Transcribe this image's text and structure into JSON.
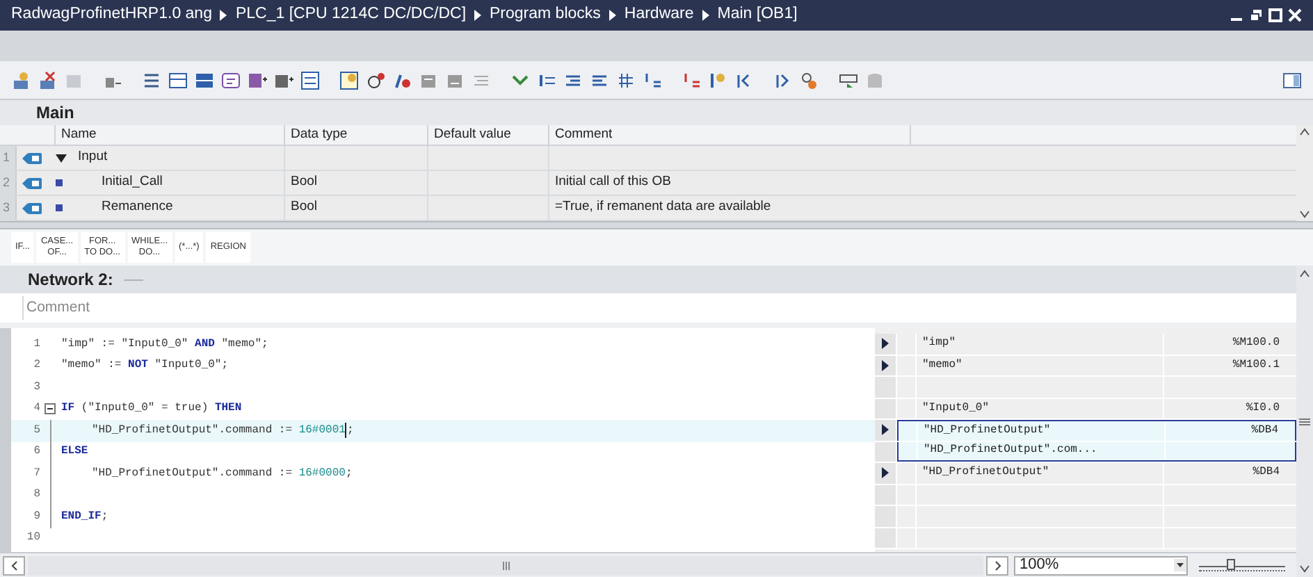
{
  "window": {
    "title_path": [
      "RadwagProfinetHRP1.0 ang",
      "PLC_1 [CPU 1214C DC/DC/DC]",
      "Program blocks",
      "Hardware",
      "Main [OB1]"
    ]
  },
  "block_interface": {
    "title": "Main",
    "columns": [
      "Name",
      "Data type",
      "Default value",
      "Comment"
    ],
    "rows": [
      {
        "number": "1",
        "name": "Input",
        "kind": "section",
        "expanded": true
      },
      {
        "number": "2",
        "name": "Initial_Call",
        "data_type": "Bool",
        "comment": "Initial call of this OB",
        "kind": "member"
      },
      {
        "number": "3",
        "name": "Remanence",
        "data_type": "Bool",
        "comment": "=True, if remanent data are available",
        "kind": "member"
      }
    ]
  },
  "snippets": [
    {
      "line1": "IF..."
    },
    {
      "line1": "CASE...",
      "line2": "OF..."
    },
    {
      "line1": "FOR...",
      "line2": "TO DO..."
    },
    {
      "line1": "WHILE...",
      "line2": "DO..."
    },
    {
      "line1": "(*...*)"
    },
    {
      "line1": "REGION"
    }
  ],
  "network": {
    "title": "Network 2:",
    "comment_placeholder": "Comment"
  },
  "code_lines": [
    {
      "number": "1",
      "fold": false,
      "selected": false,
      "tokens": [
        {
          "kind": "text",
          "text": "\"imp\" := \"Input0_0\" "
        },
        {
          "kind": "keyword",
          "text": "AND"
        },
        {
          "kind": "text",
          "text": " \"memo\";"
        }
      ]
    },
    {
      "number": "2",
      "fold": false,
      "selected": false,
      "tokens": [
        {
          "kind": "text",
          "text": "\"memo\" := "
        },
        {
          "kind": "keyword",
          "text": "NOT"
        },
        {
          "kind": "text",
          "text": " \"Input0_0\";"
        }
      ]
    },
    {
      "number": "3",
      "fold": false,
      "selected": false
    },
    {
      "number": "4",
      "fold": true,
      "selected": false,
      "tokens": [
        {
          "kind": "keyword",
          "text": "IF"
        },
        {
          "kind": "text",
          "text": " (\"Input0_0\" = true) "
        },
        {
          "kind": "keyword",
          "text": "THEN"
        }
      ]
    },
    {
      "number": "5",
      "fold": false,
      "selected": true,
      "indented": true,
      "tokens": [
        {
          "kind": "text",
          "text": "\"HD_ProfinetOutput\".command := "
        },
        {
          "kind": "number",
          "text": "16#0001"
        },
        {
          "kind": "cursor"
        },
        {
          "kind": "text",
          "text": ";"
        }
      ]
    },
    {
      "number": "6",
      "fold": false,
      "selected": false,
      "tokens": [
        {
          "kind": "keyword",
          "text": "ELSE"
        }
      ]
    },
    {
      "number": "7",
      "fold": false,
      "selected": false,
      "indented": true,
      "tokens": [
        {
          "kind": "text",
          "text": "\"HD_ProfinetOutput\".command := "
        },
        {
          "kind": "number",
          "text": "16#0000"
        },
        {
          "kind": "text",
          "text": ";"
        }
      ]
    },
    {
      "number": "8",
      "fold": false,
      "selected": false
    },
    {
      "number": "9",
      "fold": false,
      "selected": false,
      "tokens": [
        {
          "kind": "keyword",
          "text": "END_IF"
        },
        {
          "kind": "text",
          "text": ";"
        }
      ]
    },
    {
      "number": "10",
      "fold": false,
      "selected": false
    }
  ],
  "operands": [
    {
      "arrow": true,
      "selected": false,
      "tag": "\"imp\"",
      "address": "%M100.0"
    },
    {
      "arrow": true,
      "selected": false,
      "tag": "\"memo\"",
      "address": "%M100.1"
    },
    {
      "arrow": false,
      "selected": false
    },
    {
      "arrow": false,
      "selected": false,
      "tag": "\"Input0_0\"",
      "address": "%I0.0"
    },
    {
      "arrow": true,
      "selected": true,
      "tag": "\"HD_ProfinetOutput\"",
      "address": "%DB4"
    },
    {
      "arrow": false,
      "selected": true,
      "tag": "\"HD_ProfinetOutput\".com..."
    },
    {
      "arrow": true,
      "selected": false,
      "tag": "\"HD_ProfinetOutput\"",
      "address": "%DB4"
    },
    {
      "arrow": false,
      "selected": false
    },
    {
      "arrow": false,
      "selected": false
    },
    {
      "arrow": false,
      "selected": false
    }
  ],
  "zoom": {
    "value": "100%",
    "level": 0.35
  }
}
